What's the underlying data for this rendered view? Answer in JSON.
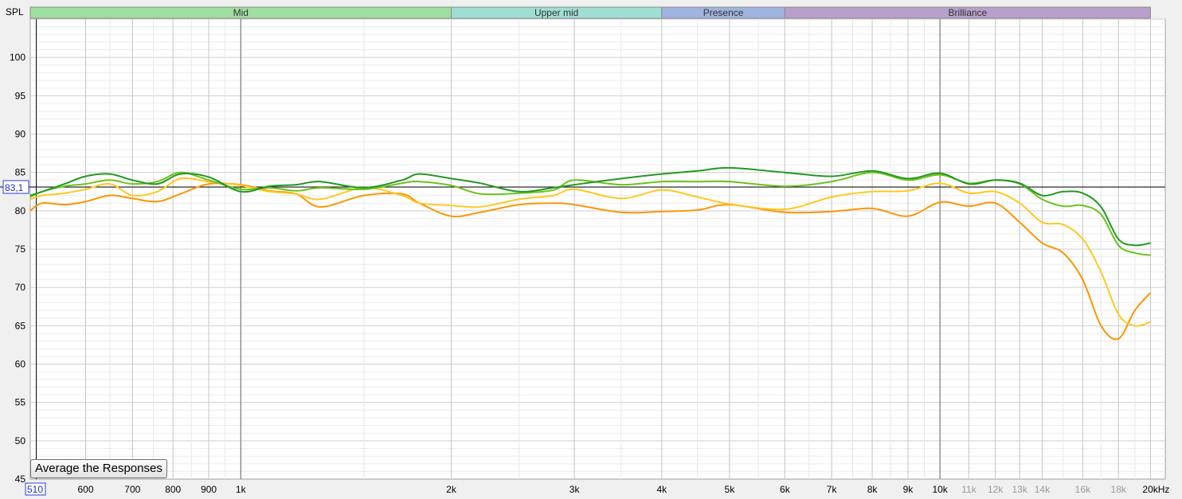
{
  "chart_data": {
    "type": "line",
    "ylabel": "SPL",
    "xscale": "log",
    "xlim": [
      500,
      21000
    ],
    "ylim": [
      45,
      105
    ],
    "grid": true,
    "yticks": [
      {
        "v": 45,
        "label": "45"
      },
      {
        "v": 50,
        "label": "50"
      },
      {
        "v": 55,
        "label": "55"
      },
      {
        "v": 60,
        "label": "60"
      },
      {
        "v": 65,
        "label": "65"
      },
      {
        "v": 70,
        "label": "70"
      },
      {
        "v": 75,
        "label": "75"
      },
      {
        "v": 80,
        "label": "80"
      },
      {
        "v": 85,
        "label": "85"
      },
      {
        "v": 90,
        "label": "90"
      },
      {
        "v": 95,
        "label": "95"
      },
      {
        "v": 100,
        "label": "100"
      }
    ],
    "xticks": [
      {
        "v": 600,
        "label": "600",
        "minor": false
      },
      {
        "v": 700,
        "label": "700",
        "minor": false
      },
      {
        "v": 800,
        "label": "800",
        "minor": false
      },
      {
        "v": 900,
        "label": "900",
        "minor": false
      },
      {
        "v": 1000,
        "label": "1k",
        "minor": false
      },
      {
        "v": 2000,
        "label": "2k",
        "minor": false
      },
      {
        "v": 3000,
        "label": "3k",
        "minor": false
      },
      {
        "v": 4000,
        "label": "4k",
        "minor": false
      },
      {
        "v": 5000,
        "label": "5k",
        "minor": false
      },
      {
        "v": 6000,
        "label": "6k",
        "minor": false
      },
      {
        "v": 7000,
        "label": "7k",
        "minor": false
      },
      {
        "v": 8000,
        "label": "8k",
        "minor": false
      },
      {
        "v": 9000,
        "label": "9k",
        "minor": false
      },
      {
        "v": 10000,
        "label": "10k",
        "minor": false
      },
      {
        "v": 11000,
        "label": "11k",
        "minor": true
      },
      {
        "v": 12000,
        "label": "12k",
        "minor": true
      },
      {
        "v": 13000,
        "label": "13k",
        "minor": true
      },
      {
        "v": 14000,
        "label": "14k",
        "minor": true
      },
      {
        "v": 16000,
        "label": "16k",
        "minor": true
      },
      {
        "v": 18000,
        "label": "18k",
        "minor": true
      },
      {
        "v": 20000,
        "label": "20kHz",
        "minor": false
      }
    ],
    "x_start_readout": "510",
    "bands": [
      {
        "name": "Mid",
        "from": 500,
        "to": 2000,
        "color": "#9fdf9f"
      },
      {
        "name": "Upper mid",
        "from": 2000,
        "to": 4000,
        "color": "#9fdfd3"
      },
      {
        "name": "Presence",
        "from": 4000,
        "to": 6000,
        "color": "#a0b4df"
      },
      {
        "name": "Brilliance",
        "from": 6000,
        "to": 20000,
        "color": "#b89fcc"
      }
    ],
    "reference": {
      "value": 83.1,
      "label": "83,1",
      "color": "#000000"
    },
    "series": [
      {
        "color": "#229922",
        "points": [
          [
            500,
            82
          ],
          [
            520,
            82.5
          ],
          [
            560,
            83.5
          ],
          [
            600,
            84.5
          ],
          [
            650,
            84.8
          ],
          [
            700,
            84
          ],
          [
            760,
            83.5
          ],
          [
            820,
            84.8
          ],
          [
            900,
            84.4
          ],
          [
            1000,
            82.5
          ],
          [
            1100,
            83.2
          ],
          [
            1200,
            83.4
          ],
          [
            1300,
            83.8
          ],
          [
            1500,
            83
          ],
          [
            1700,
            84
          ],
          [
            1800,
            84.8
          ],
          [
            2000,
            84.2
          ],
          [
            2200,
            83.6
          ],
          [
            2500,
            82.5
          ],
          [
            2800,
            83
          ],
          [
            3000,
            83.4
          ],
          [
            3500,
            84.2
          ],
          [
            4000,
            84.8
          ],
          [
            4500,
            85.2
          ],
          [
            5000,
            85.6
          ],
          [
            6000,
            85
          ],
          [
            7000,
            84.5
          ],
          [
            8000,
            85.2
          ],
          [
            9000,
            84.2
          ],
          [
            10000,
            84.9
          ],
          [
            11000,
            83.5
          ],
          [
            12000,
            84
          ],
          [
            13000,
            83.6
          ],
          [
            14000,
            82
          ],
          [
            15000,
            82.5
          ],
          [
            16000,
            82.3
          ],
          [
            17000,
            80.5
          ],
          [
            18000,
            76.3
          ],
          [
            19000,
            75.5
          ],
          [
            20000,
            75.8
          ]
        ]
      },
      {
        "color": "#6cc31a",
        "points": [
          [
            500,
            81.8
          ],
          [
            520,
            82.5
          ],
          [
            560,
            83.2
          ],
          [
            600,
            83.5
          ],
          [
            650,
            84
          ],
          [
            700,
            83.5
          ],
          [
            760,
            83.8
          ],
          [
            820,
            85
          ],
          [
            900,
            84
          ],
          [
            1000,
            82.8
          ],
          [
            1100,
            83
          ],
          [
            1200,
            82.6
          ],
          [
            1300,
            83
          ],
          [
            1500,
            82.8
          ],
          [
            1700,
            83.6
          ],
          [
            1800,
            83.8
          ],
          [
            2000,
            83.3
          ],
          [
            2200,
            82.2
          ],
          [
            2500,
            82.3
          ],
          [
            2800,
            82.7
          ],
          [
            3000,
            84
          ],
          [
            3500,
            83.4
          ],
          [
            4000,
            83.8
          ],
          [
            4500,
            83.8
          ],
          [
            5000,
            83.8
          ],
          [
            6000,
            83.2
          ],
          [
            7000,
            83.8
          ],
          [
            8000,
            85
          ],
          [
            9000,
            84
          ],
          [
            10000,
            84.7
          ],
          [
            11000,
            83.6
          ],
          [
            12000,
            84
          ],
          [
            13000,
            83.5
          ],
          [
            14000,
            81.5
          ],
          [
            15000,
            80.6
          ],
          [
            16000,
            80.7
          ],
          [
            17000,
            79.5
          ],
          [
            18000,
            75.5
          ],
          [
            19000,
            74.5
          ],
          [
            20000,
            74.2
          ]
        ]
      },
      {
        "color": "#ffc820",
        "points": [
          [
            500,
            81.5
          ],
          [
            520,
            82
          ],
          [
            560,
            82.3
          ],
          [
            600,
            82.8
          ],
          [
            650,
            83.5
          ],
          [
            700,
            82
          ],
          [
            760,
            82.5
          ],
          [
            820,
            84.2
          ],
          [
            900,
            83.8
          ],
          [
            1000,
            83.3
          ],
          [
            1100,
            82.5
          ],
          [
            1200,
            82.2
          ],
          [
            1300,
            81.5
          ],
          [
            1500,
            83
          ],
          [
            1700,
            82
          ],
          [
            1800,
            81
          ],
          [
            2000,
            80.7
          ],
          [
            2200,
            80.5
          ],
          [
            2500,
            81.5
          ],
          [
            2800,
            82
          ],
          [
            3000,
            82.8
          ],
          [
            3500,
            81.6
          ],
          [
            4000,
            82.7
          ],
          [
            4500,
            81.8
          ],
          [
            5000,
            80.9
          ],
          [
            6000,
            80.2
          ],
          [
            7000,
            81.8
          ],
          [
            8000,
            82.5
          ],
          [
            9000,
            82.6
          ],
          [
            10000,
            83.6
          ],
          [
            11000,
            82.3
          ],
          [
            12000,
            82.5
          ],
          [
            13000,
            81
          ],
          [
            14000,
            78.5
          ],
          [
            15000,
            78.2
          ],
          [
            16000,
            76.3
          ],
          [
            17000,
            72
          ],
          [
            18000,
            66.5
          ],
          [
            19000,
            65
          ],
          [
            20000,
            65.5
          ]
        ]
      },
      {
        "color": "#ff9500",
        "points": [
          [
            500,
            80
          ],
          [
            520,
            81
          ],
          [
            560,
            80.8
          ],
          [
            600,
            81.2
          ],
          [
            650,
            82
          ],
          [
            700,
            81.6
          ],
          [
            760,
            81.2
          ],
          [
            820,
            82.2
          ],
          [
            900,
            83.5
          ],
          [
            1000,
            83.4
          ],
          [
            1100,
            82.6
          ],
          [
            1200,
            82.2
          ],
          [
            1300,
            80.5
          ],
          [
            1500,
            82
          ],
          [
            1700,
            82.2
          ],
          [
            1800,
            81
          ],
          [
            2000,
            79.3
          ],
          [
            2200,
            79.8
          ],
          [
            2500,
            80.8
          ],
          [
            2800,
            81
          ],
          [
            3000,
            80.8
          ],
          [
            3500,
            79.8
          ],
          [
            4000,
            79.9
          ],
          [
            4500,
            80.1
          ],
          [
            5000,
            80.8
          ],
          [
            6000,
            79.8
          ],
          [
            7000,
            79.9
          ],
          [
            8000,
            80.3
          ],
          [
            9000,
            79.3
          ],
          [
            10000,
            81.1
          ],
          [
            11000,
            80.6
          ],
          [
            12000,
            81
          ],
          [
            13000,
            78.5
          ],
          [
            14000,
            75.8
          ],
          [
            15000,
            74.5
          ],
          [
            16000,
            71
          ],
          [
            17000,
            65
          ],
          [
            18000,
            63.3
          ],
          [
            19000,
            67
          ],
          [
            20000,
            69.3
          ]
        ]
      }
    ]
  },
  "controls": {
    "average_button": "Average the Responses"
  }
}
